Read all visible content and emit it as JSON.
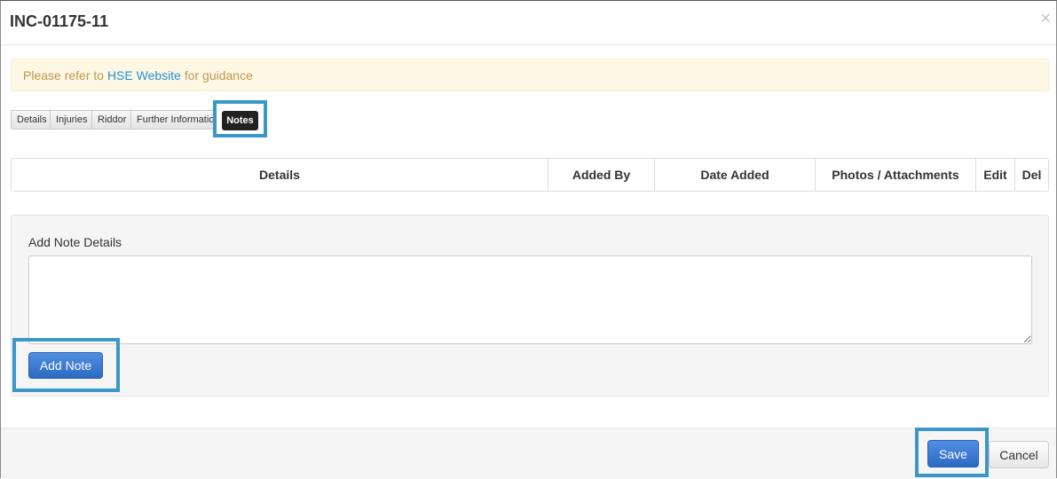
{
  "modal": {
    "title": "INC-01175-11",
    "close_glyph": "×"
  },
  "alert": {
    "prefix": "Please refer to ",
    "link_text": "HSE Website",
    "suffix": " for guidance"
  },
  "tabs": [
    {
      "label": "Details",
      "active": false
    },
    {
      "label": "Injuries",
      "active": false
    },
    {
      "label": "Riddor",
      "active": false
    },
    {
      "label": "Further Information",
      "active": false
    },
    {
      "label": "Notes",
      "active": true
    }
  ],
  "notes_table": {
    "columns": [
      "Details",
      "Added By",
      "Date Added",
      "Photos / Attachments",
      "Edit",
      "Del"
    ],
    "rows": []
  },
  "add_note": {
    "label": "Add Note Details",
    "textarea_value": "",
    "button_label": "Add Note"
  },
  "footer": {
    "save_label": "Save",
    "cancel_label": "Cancel"
  },
  "colors": {
    "highlight": "#3c97c9",
    "primary": "#3a7bd5",
    "alert_text": "#c09853",
    "link": "#2a8fd4",
    "active_tab": "#222222"
  }
}
